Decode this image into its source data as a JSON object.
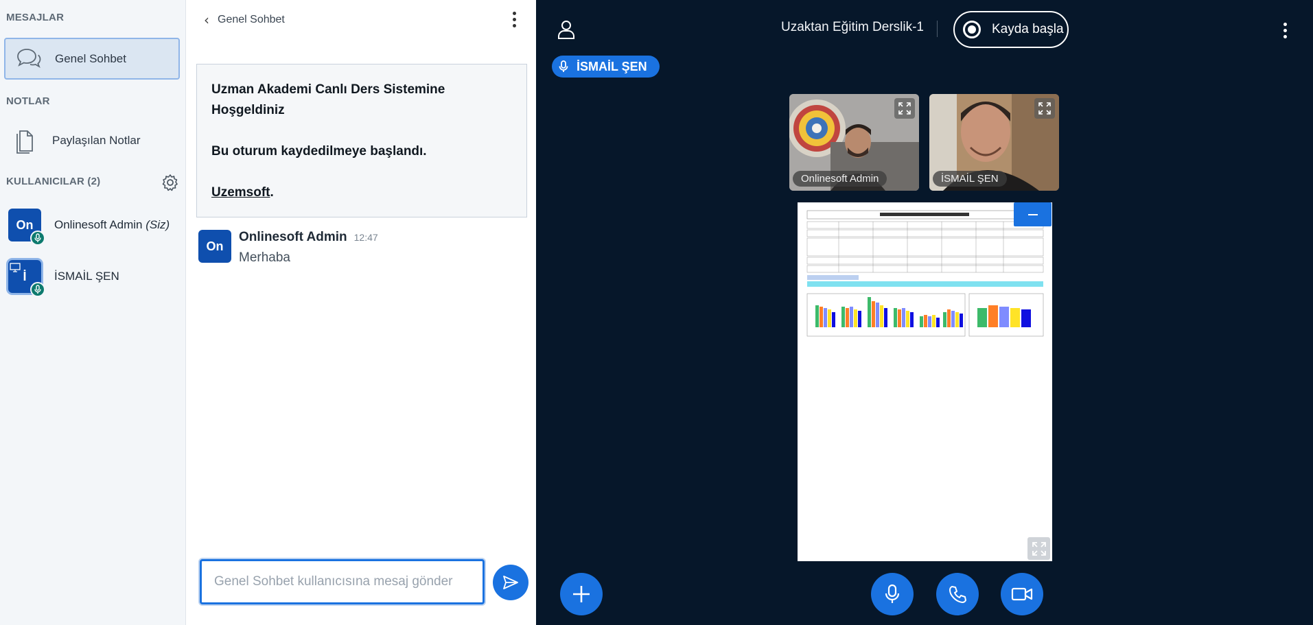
{
  "sidebar": {
    "messages_title": "MESAJLAR",
    "chat_item": "Genel Sohbet",
    "notes_title": "NOTLAR",
    "shared_notes": "Paylaşılan Notlar",
    "users_title": "KULLANICILAR (2)",
    "users": [
      {
        "initials": "On",
        "name": "Onlinesoft Admin",
        "you": "(Siz)"
      },
      {
        "initials": "İ",
        "name": "İSMAİL ŞEN"
      }
    ]
  },
  "chat": {
    "title": "Genel Sohbet",
    "welcome": {
      "line1": "Uzman Akademi Canlı Ders Sistemine Hoşgeldiniz",
      "line2": "Bu oturum kaydedilmeye başlandı.",
      "link": "Uzemsoft",
      "link_suffix": "."
    },
    "messages": [
      {
        "initials": "On",
        "author": "Onlinesoft Admin",
        "time": "12:47",
        "text": "Merhaba"
      }
    ],
    "input_placeholder": "Genel Sohbet kullanıcısına mesaj gönder"
  },
  "meeting": {
    "title": "Uzaktan Eğitim Derslik-1",
    "record_label": "Kayda başla",
    "talker": "İSMAİL ŞEN",
    "cams": [
      {
        "name": "Onlinesoft Admin"
      },
      {
        "name": "İSMAİL ŞEN"
      }
    ]
  },
  "colors": {
    "accent": "#1a72e0",
    "dark_bg": "#06172a",
    "avatar": "#0f4fae",
    "mic_badge": "#0c7a6e"
  }
}
